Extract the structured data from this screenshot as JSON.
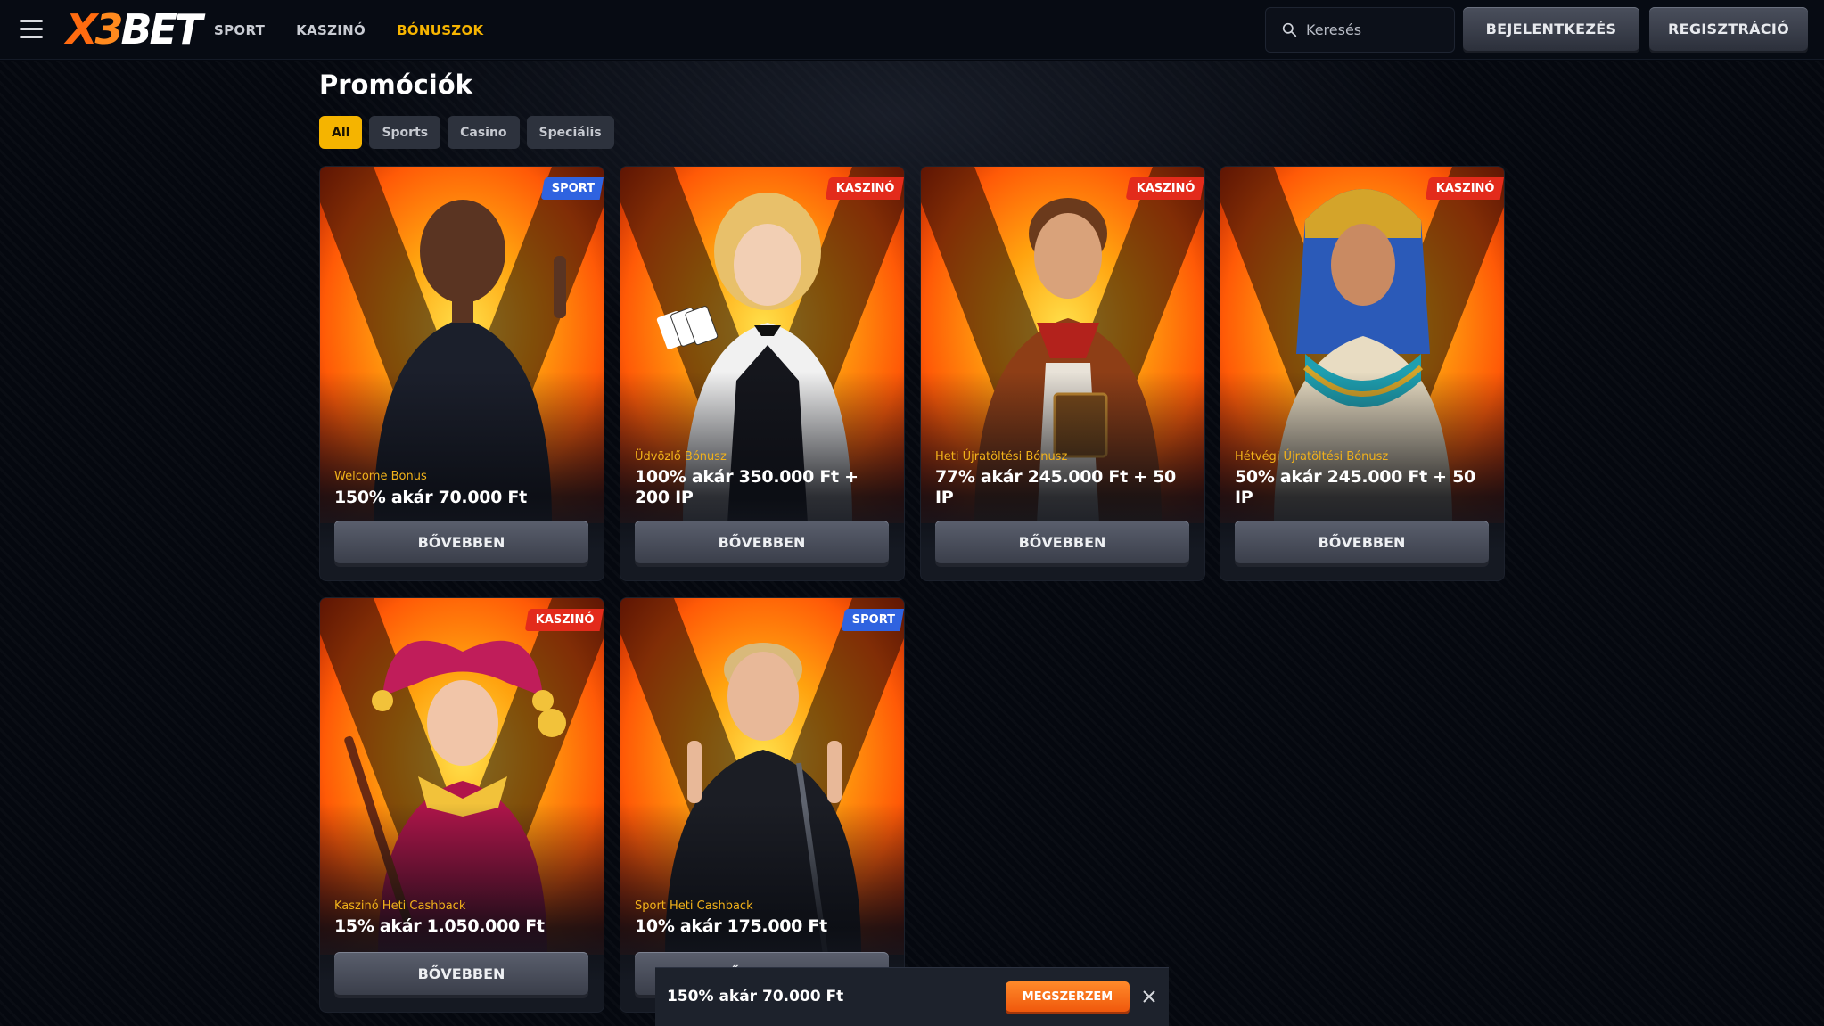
{
  "header": {
    "logo": {
      "x": "X",
      "three": "3",
      "rest": "BET"
    },
    "nav": [
      {
        "label": "SPORT",
        "active": false
      },
      {
        "label": "KASZINÓ",
        "active": false
      },
      {
        "label": "BÓNUSZOK",
        "active": true
      }
    ],
    "search_placeholder": "Keresés",
    "login_label": "BEJELENTKEZÉS",
    "register_label": "REGISZTRÁCIÓ"
  },
  "page": {
    "title": "Promóciók",
    "filters": [
      {
        "label": "All",
        "active": true
      },
      {
        "label": "Sports",
        "active": false
      },
      {
        "label": "Casino",
        "active": false
      },
      {
        "label": "Speciális",
        "active": false
      }
    ]
  },
  "cards": [
    {
      "badge": "SPORT",
      "badge_type": "sport",
      "category": "Welcome Bonus",
      "offer": "150% akár 70.000 Ft",
      "button": "BŐVEBBEN",
      "figure": "footballer-blue-kit"
    },
    {
      "badge": "KASZINÓ",
      "badge_type": "casino",
      "category": "Üdvözlő Bónusz",
      "offer": "100% akár 350.000 Ft + 200 IP",
      "button": "BŐVEBBEN",
      "figure": "croupier-with-cards"
    },
    {
      "badge": "KASZINÓ",
      "badge_type": "casino",
      "category": "Heti Újratöltési Bónusz",
      "offer": "77% akár 245.000 Ft + 50 IP",
      "button": "BŐVEBBEN",
      "figure": "cowboy-with-book"
    },
    {
      "badge": "KASZINÓ",
      "badge_type": "casino",
      "category": "Hétvégi Újratöltési Bónusz",
      "offer": "50% akár 245.000 Ft + 50 IP",
      "button": "BŐVEBBEN",
      "figure": "pharaoh-queen"
    },
    {
      "badge": "KASZINÓ",
      "badge_type": "casino",
      "category": "Kaszinó Heti Cashback",
      "offer": "15% akár 1.050.000 Ft",
      "button": "BŐVEBBEN",
      "figure": "jester-woman"
    },
    {
      "badge": "SPORT",
      "badge_type": "sport",
      "category": "Sport Heti Cashback",
      "offer": "10% akár 175.000 Ft",
      "button": "BŐVEBBEN",
      "figure": "footballer-dark-kit"
    }
  ],
  "promo_bar": {
    "text": "150% akár 70.000 Ft",
    "claim_label": "MEGSZERZEM"
  },
  "colors": {
    "accent": "#f5b400",
    "sport_badge": "#2f63e0",
    "casino_badge": "#e32b1b",
    "claim": "#f0580c"
  }
}
